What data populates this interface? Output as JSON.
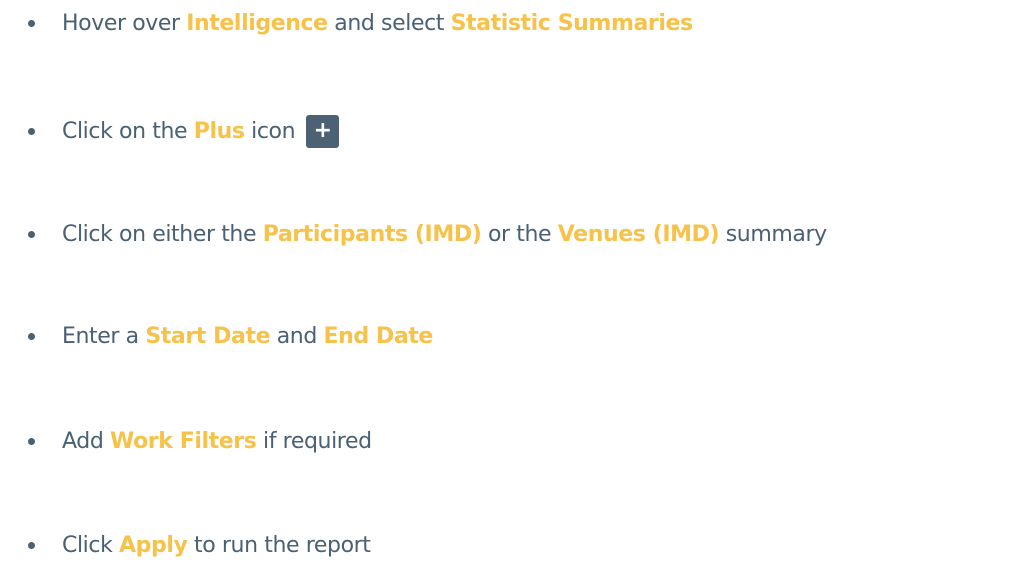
{
  "steps": [
    {
      "parts": [
        "Hover over ",
        "Intelligence",
        " and select ",
        "Statistic Summaries"
      ]
    },
    {
      "parts": [
        "Click on the ",
        "Plus",
        " icon"
      ],
      "icon": "plus-icon",
      "icon_glyph": "+"
    },
    {
      "parts": [
        "Click on either the ",
        "Participants (IMD)",
        " or the ",
        "Venues (IMD)",
        " summary"
      ]
    },
    {
      "parts": [
        "Enter a ",
        "Start Date",
        " and ",
        "End Date"
      ]
    },
    {
      "parts": [
        "Add ",
        "Work Filters",
        " if required"
      ]
    },
    {
      "parts": [
        "Click ",
        "Apply",
        " to run the report"
      ]
    }
  ],
  "colors": {
    "text": "#4a6074",
    "highlight": "#f7c24a",
    "button_bg": "#4d6175"
  }
}
